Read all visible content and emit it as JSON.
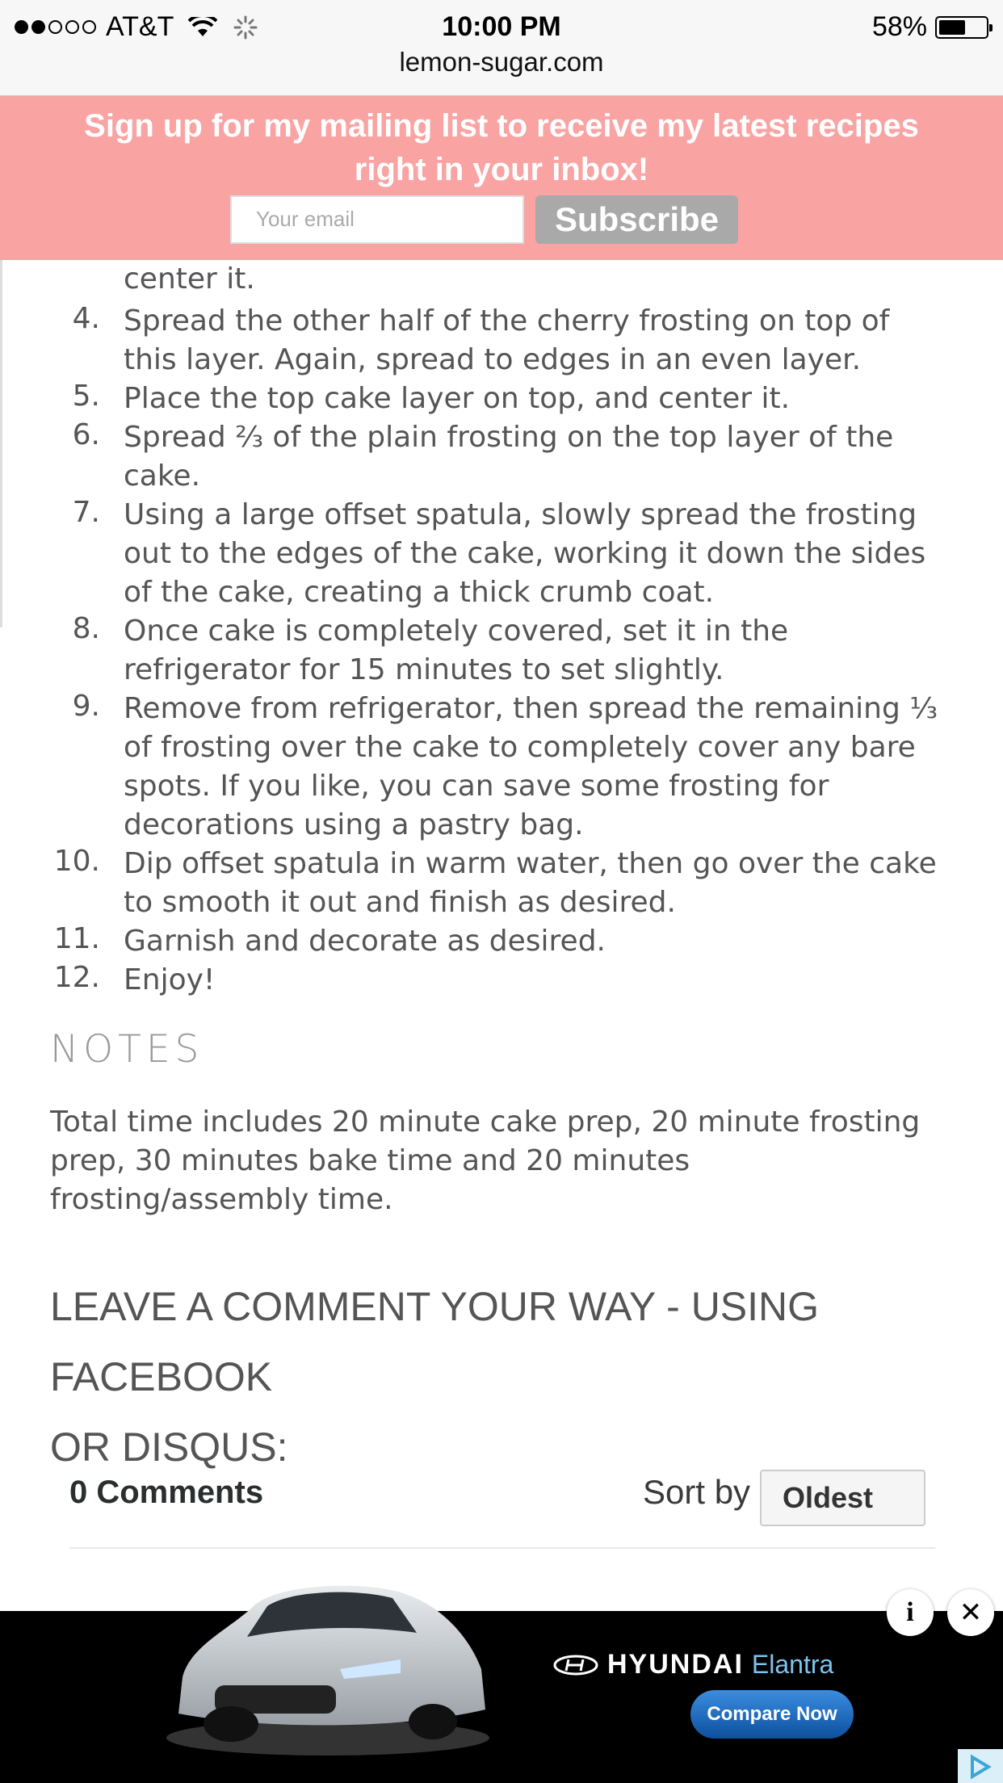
{
  "status_bar": {
    "carrier": "AT&T",
    "time": "10:00 PM",
    "battery": "58%",
    "battery_level": 0.58,
    "signal_bars": 2,
    "signal_total": 5
  },
  "browser": {
    "url": "lemon-sugar.com"
  },
  "mailing_banner": {
    "line1": "Sign up for my mailing list to receive my latest recipes",
    "line2": "right in your inbox!",
    "email_placeholder": "Your email",
    "subscribe_label": "Subscribe",
    "background": "#f9a3a3"
  },
  "recipe": {
    "partial_line": "center it.",
    "steps": [
      {
        "num": "4.",
        "lines": [
          "Spread the other half of the cherry frosting on top of",
          "this layer. Again, spread to edges in an even layer."
        ]
      },
      {
        "num": "5.",
        "lines": [
          "Place the top cake layer on top, and center it."
        ]
      },
      {
        "num": "6.",
        "lines": [
          "Spread ⅔ of the plain frosting on the top layer of the",
          "cake."
        ]
      },
      {
        "num": "7.",
        "lines": [
          "Using a large offset spatula, slowly spread the frosting",
          "out to the edges of the cake, working it down the sides",
          "of the cake, creating a thick crumb coat."
        ]
      },
      {
        "num": "8.",
        "lines": [
          "Once cake is completely covered, set it in the",
          "refrigerator for 15 minutes to set slightly."
        ]
      },
      {
        "num": "9.",
        "lines": [
          "Remove from refrigerator, then spread the remaining ⅓",
          "of frosting over the cake to completely cover any bare",
          "spots. If you like, you can save some frosting for",
          "decorations using a pastry bag."
        ]
      },
      {
        "num": "10.",
        "lines": [
          "Dip offset spatula in warm water, then go over the cake",
          "to smooth it out and finish as desired."
        ]
      },
      {
        "num": "11.",
        "lines": [
          "Garnish and decorate as desired."
        ]
      },
      {
        "num": "12.",
        "lines": [
          "Enjoy!"
        ]
      }
    ],
    "notes_heading": "NOTES",
    "notes_lines": [
      "Total time includes 20 minute cake prep, 20 minute frosting",
      "prep, 30 minutes bake time and 20 minutes",
      "frosting/assembly time."
    ]
  },
  "comments": {
    "heading_lines": [
      "LEAVE A COMMENT YOUR WAY - USING FACEBOOK",
      "OR DISQUS:"
    ],
    "count_label": "0 Comments",
    "sort_label": "Sort by",
    "sort_value": "Oldest"
  },
  "ad": {
    "brand": "HYUNDAI",
    "model": "Elantra",
    "cta": "Compare Now",
    "info_icon": "info-icon",
    "close_icon": "close-icon"
  }
}
